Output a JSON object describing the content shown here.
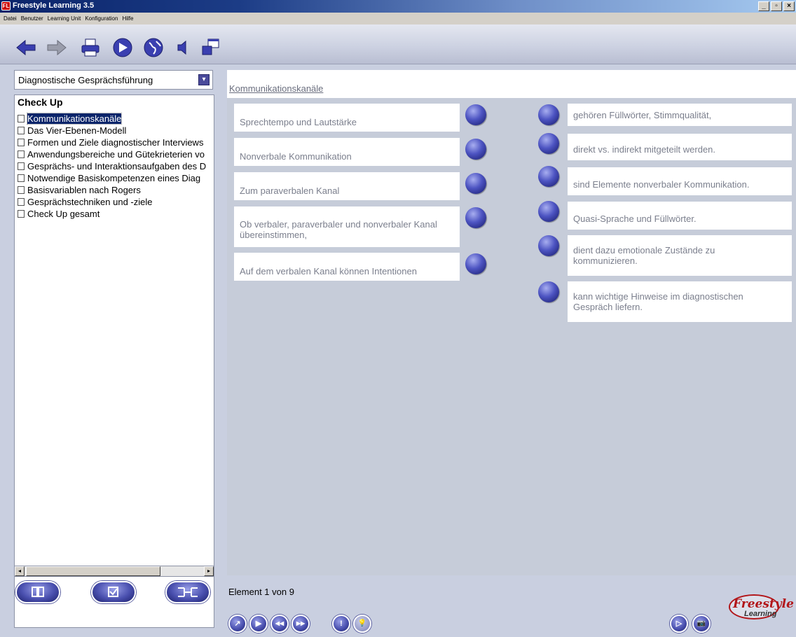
{
  "window": {
    "title": "Freestyle Learning 3.5",
    "icon_label": "FL",
    "buttons": [
      "_",
      "▫",
      "×"
    ]
  },
  "menu": [
    "Datei",
    "Benutzer",
    "Learning Unit",
    "Konfiguration",
    "Hilfe"
  ],
  "toolbar": {
    "icons": [
      "back-arrow-icon",
      "forward-arrow-icon",
      "print-icon",
      "navigate-icon",
      "globe-icon",
      "sound-icon",
      "window-icon"
    ]
  },
  "sidebar": {
    "select_value": "Diagnostische Gesprächsführung",
    "tree_root": "Check Up",
    "items": [
      "Kommunikationskanäle",
      "Das Vier-Ebenen-Modell",
      "Formen und Ziele diagnostischer Interviews",
      "Anwendungsbereiche und Gütekrieterien vo",
      "Gesprächs- und Interaktionsaufgaben des D",
      "Notwendige Basiskompetenzen eines Diag",
      "Basisvariablen nach Rogers",
      "Gesprächstechniken und -ziele",
      "Check Up gesamt"
    ],
    "selected_index": 0,
    "bottom_buttons": [
      "book-icon",
      "checkbox-icon",
      "connect-icon"
    ],
    "select_button_glyph": "▾",
    "scroll_left": "◂",
    "scroll_right": "▸"
  },
  "main": {
    "header_link": "Kommunikationskanäle",
    "left_items": [
      "Sprechtempo und Lautstärke",
      "Nonverbale Kommunikation",
      "Zum paraverbalen Kanal",
      "Ob verbaler, paraverbaler und nonverbaler Kanal übereinstimmen,",
      "Auf dem verbalen Kanal können Intentionen"
    ],
    "right_items": [
      "gehören Füllwörter, Stimmqualität,",
      "direkt vs. indirekt mitgeteilt werden.",
      "sind Elemente nonverbaler Kommunikation.",
      "Quasi-Sprache und Füllwörter.",
      "dient dazu emotionale Zustände zu kommunizieren.",
      "kann wichtige Hinweise im diagnostischen Gespräch liefern."
    ],
    "status": "Element 1 von 9",
    "logo_word1": "Freestyle",
    "logo_word2": "Learning",
    "bottom_buttons": [
      {
        "glyph": "↗",
        "icon": "chart-icon"
      },
      {
        "glyph": "▶",
        "icon": "play-icon"
      },
      {
        "glyph": "◀◀",
        "icon": "rewind-icon"
      },
      {
        "glyph": "▶▶",
        "icon": "fast-forward-icon"
      },
      {
        "glyph": "!",
        "icon": "exclamation-icon"
      },
      {
        "glyph": "💡",
        "icon": "lightbulb-icon"
      },
      {
        "glyph": "▷",
        "icon": "next-icon"
      },
      {
        "glyph": "📷",
        "icon": "camera-icon"
      }
    ]
  }
}
